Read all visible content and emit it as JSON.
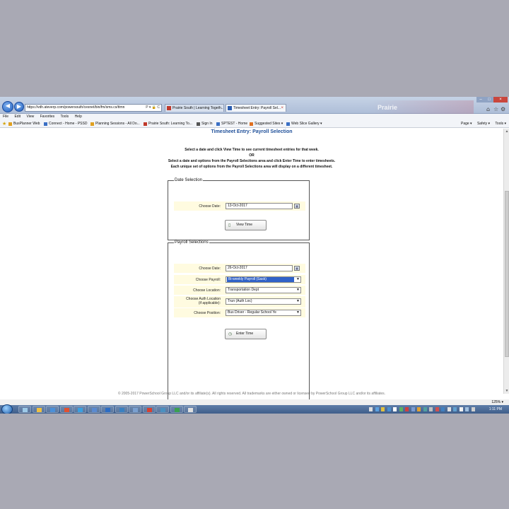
{
  "browser": {
    "address": "https://vdh.ateverp.com/powersouth/cesnet/bin/fm/sms.cs/ttmn",
    "address_icons": "P ▾ 🔒 C",
    "tabs": [
      {
        "label": "Prairie South | Learning Togeth..."
      },
      {
        "label": "Timesheet Entry: Payroll Sel...",
        "close": "×"
      }
    ],
    "brand_ghost": "Prairie",
    "window_controls": {
      "minimize": "–",
      "maximize": "□",
      "close": "×"
    },
    "toolbar_icons": [
      "⌂",
      "☆",
      "⚙"
    ]
  },
  "menubar": [
    "File",
    "Edit",
    "View",
    "Favorites",
    "Tools",
    "Help"
  ],
  "favorites": [
    {
      "label": "BusPlanner Web",
      "color": "#e0a020"
    },
    {
      "label": "Connect - Home - PSSD",
      "color": "#3a6fc4"
    },
    {
      "label": "Planning Sessions - All Do...",
      "color": "#e0a020"
    },
    {
      "label": "Prairie South: Learning To...",
      "color": "#c0392b"
    },
    {
      "label": "Sign In",
      "color": "#555555"
    },
    {
      "label": "SPTEST - Home",
      "color": "#3a6fc4"
    },
    {
      "label": "Suggested Sites ▾",
      "color": "#e07020"
    },
    {
      "label": "Web Slice Gallery ▾",
      "color": "#3a6fc4"
    }
  ],
  "commandbar": [
    "Page ▾",
    "Safety ▾",
    "Tools ▾"
  ],
  "page": {
    "title": "Timesheet Entry: Payroll Selection",
    "instructions": [
      "Select a date and click View Time to see current timesheet entries for that week.",
      "OR",
      "Select a date and options from the Payroll Selections area and click Enter Time to enter timesheets.",
      "Each unique set of options from the Payroll Selections area will display on a different timesheet."
    ],
    "date_selection": {
      "legend": "Date Selection",
      "date_label": "Choose Date:",
      "date_value": "13-Oct-2017",
      "view_button": "View Time"
    },
    "payroll_selections": {
      "legend": "Payroll Selections",
      "date_label": "Choose Date:",
      "date_value": "26-Oct-2017",
      "payroll_label": "Choose Payroll:",
      "payroll_value": "Bi-weekly Payroll (Sask)",
      "location_label": "Choose Location:",
      "location_value": "Transportation Dept",
      "auth_label_line1": "Choose Auth Location",
      "auth_label_line2": "(if applicable):",
      "auth_value": "Trun (Auth Loc)",
      "position_label": "Choose Position:",
      "position_value": "Bus Driver - Regular School Ye",
      "enter_button": "Enter Time"
    },
    "footer": "© 2005-2017 PowerSchool Group LLC and/or its affiliate(s). All rights reserved. All trademarks are either owned or licensed by PowerSchool Group LLC and/or its affiliates."
  },
  "zoom": "125% ▾",
  "taskbar": {
    "clock": "1:11 PM",
    "apps": [
      "#9ecae8",
      "#f0c040",
      "#4a8fd8",
      "#e05030",
      "#3aa0e0",
      "#5a8ad0",
      "#2b6cc4",
      "#3a80c0",
      "#7aa0d0",
      "#d84030",
      "#4a90c0",
      "#3aa050",
      "#e0e0e0"
    ]
  },
  "colors": {
    "title_blue": "#1e4f99",
    "selected_option_bg": "#3062c8",
    "row_highlight": "#fffbe0"
  }
}
